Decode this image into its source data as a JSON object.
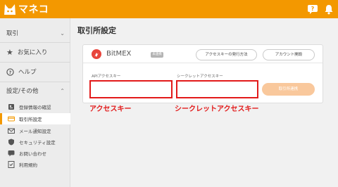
{
  "app": {
    "name": "マネコ"
  },
  "sidebar": {
    "sections": [
      {
        "label": "取引"
      },
      {
        "label": "お気に入り"
      },
      {
        "label": "ヘルプ"
      },
      {
        "label": "設定/その他"
      }
    ],
    "items": [
      {
        "label": "登録情報の確認",
        "icon": "id-card-icon"
      },
      {
        "label": "取引所設定",
        "icon": "card-icon",
        "active": true
      },
      {
        "label": "メール通知設定",
        "icon": "mail-icon"
      },
      {
        "label": "セキュリティ設定",
        "icon": "shield-icon"
      },
      {
        "label": "お問い合わせ",
        "icon": "chat-icon"
      },
      {
        "label": "利用規約",
        "icon": "checklist-icon"
      }
    ]
  },
  "page": {
    "title": "取引所設定"
  },
  "exchange": {
    "name": "BitMEX",
    "status": "未連携",
    "how_to_button": "アクセスキーの発行方法",
    "open_account_button": "アカウント開設",
    "api_key_label": "APIアクセスキー",
    "api_key_value": "",
    "secret_key_label": "シークレットアクセスキー",
    "secret_key_value": "",
    "connect_button": "取引所連携"
  },
  "annotations": {
    "api_key": "アクセスキー",
    "secret_key": "シークレットアクセスキー"
  },
  "colors": {
    "brand": "#f39800",
    "highlight": "#e21a1a",
    "bitmex_red": "#e8453c"
  }
}
